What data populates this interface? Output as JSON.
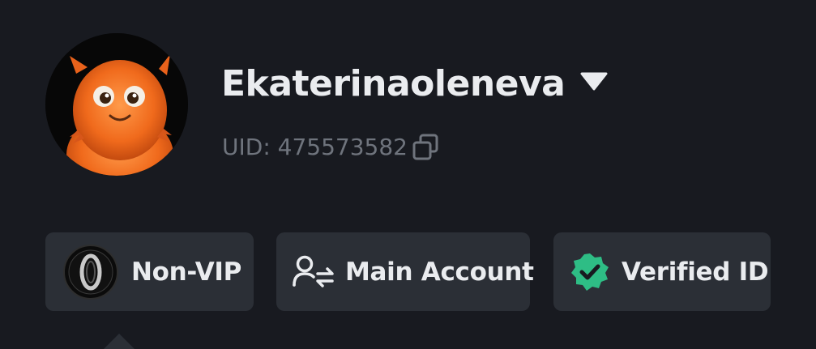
{
  "profile": {
    "username": "Ekaterinaoleneva",
    "uid_label": "UID: 475573582",
    "avatar_icon": "orange-fluffy-monster-avatar",
    "dropdown_icon": "caret-down-icon",
    "copy_icon": "copy-icon"
  },
  "badges": [
    {
      "label": "Non-VIP",
      "icon": "vip-level-zero-icon"
    },
    {
      "label": "Main Account",
      "icon": "account-switch-icon"
    },
    {
      "label": "Verified ID",
      "icon": "verified-check-icon",
      "color": "#2ebd85"
    }
  ],
  "colors": {
    "background": "#181a20",
    "pill_background": "#2b2f36",
    "text_primary": "#eaecef",
    "text_secondary": "#6f747d",
    "verified_green": "#2ebd85"
  }
}
